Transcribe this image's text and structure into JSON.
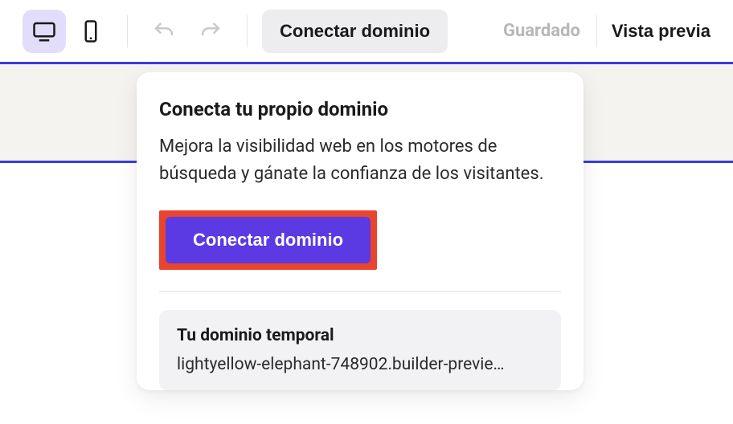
{
  "toolbar": {
    "connect_label": "Conectar dominio",
    "saved_label": "Guardado",
    "preview_label": "Vista previa"
  },
  "popover": {
    "title": "Conecta tu propio dominio",
    "description": "Mejora la visibilidad web en los motores de búsqueda y gánate la confianza de los visitantes.",
    "connect_button": "Conectar dominio",
    "temp_title": "Tu dominio temporal",
    "temp_domain": "lightyellow-elephant-748902.builder-previe…"
  }
}
